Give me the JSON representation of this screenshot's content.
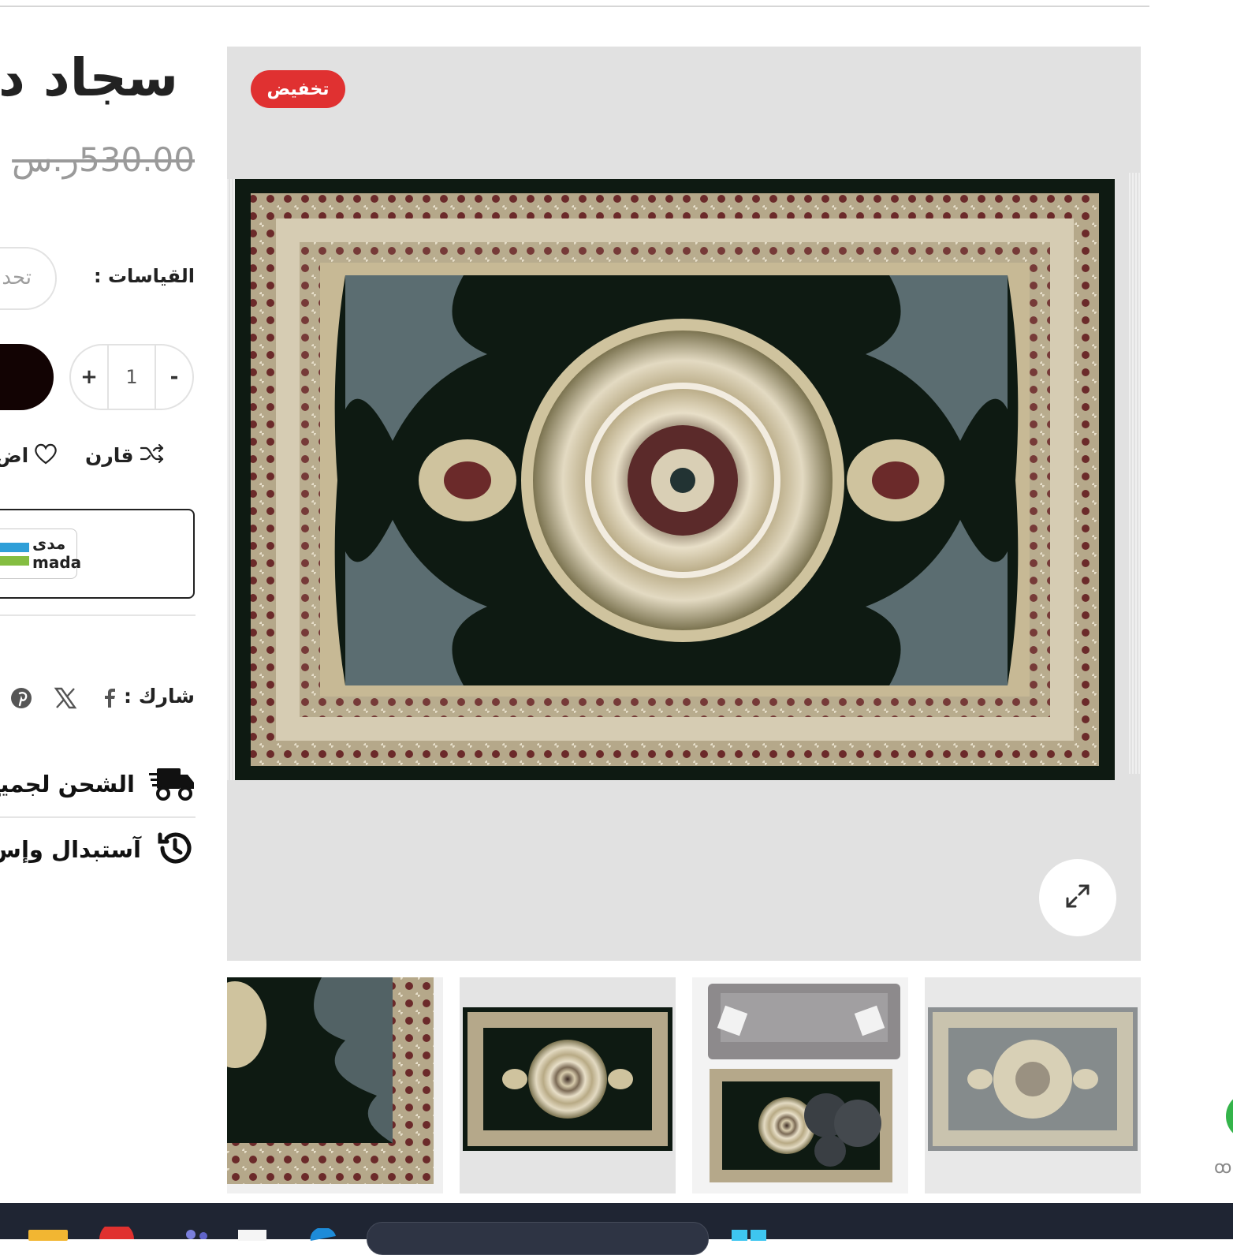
{
  "product": {
    "title": "سجاد د",
    "price_old": "530.00ر.س",
    "sale_badge": "تخفيض"
  },
  "options": {
    "size_label": "القياسات :",
    "size_placeholder": "تحد"
  },
  "cart": {
    "quantity": "1",
    "minus": "-",
    "plus": "+"
  },
  "actions": {
    "compare_label": "قارن",
    "wishlist_label": "اض"
  },
  "payment": {
    "mada_ar": "مدى",
    "mada_en": "mada"
  },
  "share": {
    "label": "شارك :",
    "networks": [
      "facebook-icon",
      "x-icon",
      "pinterest-icon"
    ]
  },
  "features": [
    {
      "icon": "shipping-truck-icon",
      "label": "الشحن لجميع"
    },
    {
      "icon": "history-icon",
      "label": "آستبدال وإس"
    }
  ],
  "gallery": {
    "thumbnails": [
      "rug-corner-detail",
      "rug-full-view",
      "rug-room-scene",
      "rug-grey-variant"
    ]
  },
  "colors": {
    "badge": "#e03131",
    "rug_field": "#101a12",
    "rug_border": "#b5a88a",
    "cart_button": "#120303",
    "taskbar": "#1f2533"
  }
}
